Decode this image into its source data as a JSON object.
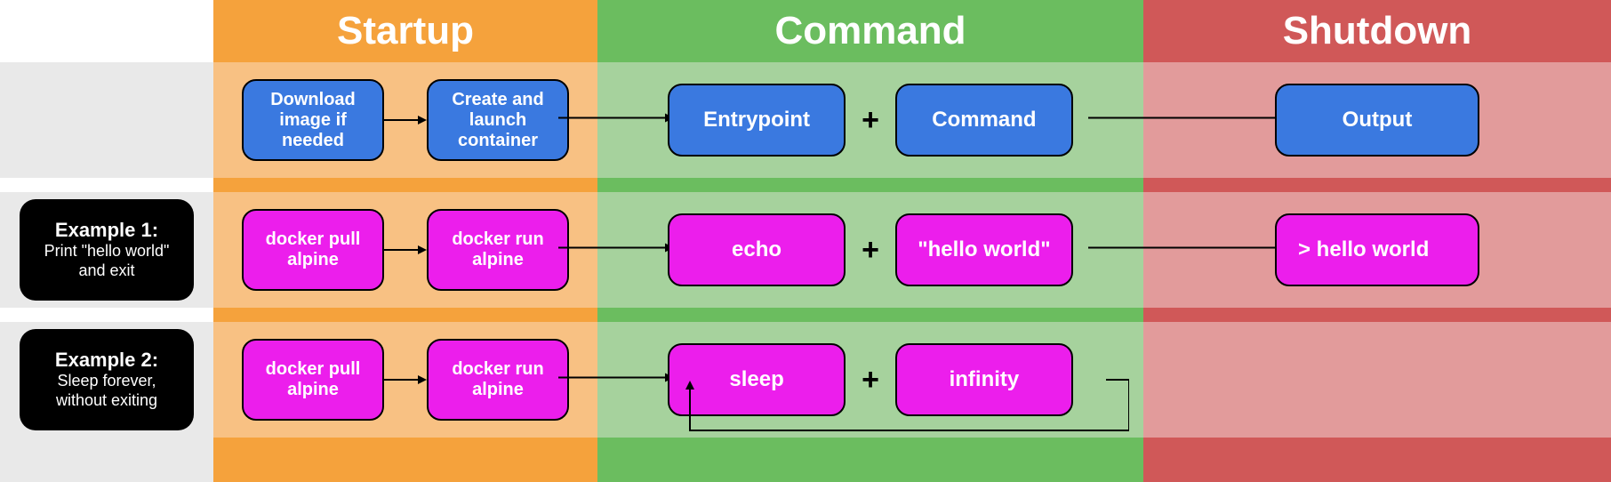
{
  "headers": {
    "startup": "Startup",
    "command": "Command",
    "shutdown": "Shutdown"
  },
  "generic_row": {
    "startup": {
      "step1": "Download\nimage if\nneeded",
      "step2": "Create and\nlaunch\ncontainer"
    },
    "command": {
      "entrypoint": "Entrypoint",
      "plus": "+",
      "command": "Command"
    },
    "shutdown": {
      "output": "Output"
    }
  },
  "ex1": {
    "label_title": "Example 1:",
    "label_desc": "Print \"hello world\"\nand exit",
    "startup": {
      "step1": "docker pull\nalpine",
      "step2": "docker run\nalpine"
    },
    "command": {
      "entrypoint": "echo",
      "plus": "+",
      "command": "\"hello world\""
    },
    "shutdown": {
      "output": "> hello world"
    }
  },
  "ex2": {
    "label_title": "Example 2:",
    "label_desc": "Sleep forever,\nwithout exiting",
    "startup": {
      "step1": "docker pull\nalpine",
      "step2": "docker run\nalpine"
    },
    "command": {
      "entrypoint": "sleep",
      "plus": "+",
      "command": "infinity"
    }
  }
}
